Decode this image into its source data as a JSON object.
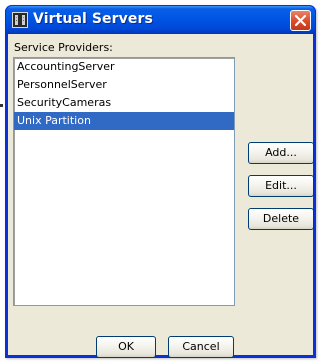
{
  "window": {
    "title": "Virtual Servers",
    "icon": "server-window-icon",
    "close_icon": "close-icon",
    "colors": {
      "titlebar": "#0055e5",
      "frame": "#0831d9",
      "body": "#ece9d8",
      "selection": "#316ac5",
      "close_button": "#d84a2a"
    }
  },
  "providers": {
    "label": "Service Providers:",
    "items": [
      {
        "label": "AccountingServer",
        "selected": false
      },
      {
        "label": "PersonnelServer",
        "selected": false
      },
      {
        "label": "SecurityCameras",
        "selected": false
      },
      {
        "label": "Unix Partition",
        "selected": true
      }
    ]
  },
  "buttons": {
    "add": "Add...",
    "edit": "Edit...",
    "delete": "Delete",
    "ok": "OK",
    "cancel": "Cancel"
  }
}
